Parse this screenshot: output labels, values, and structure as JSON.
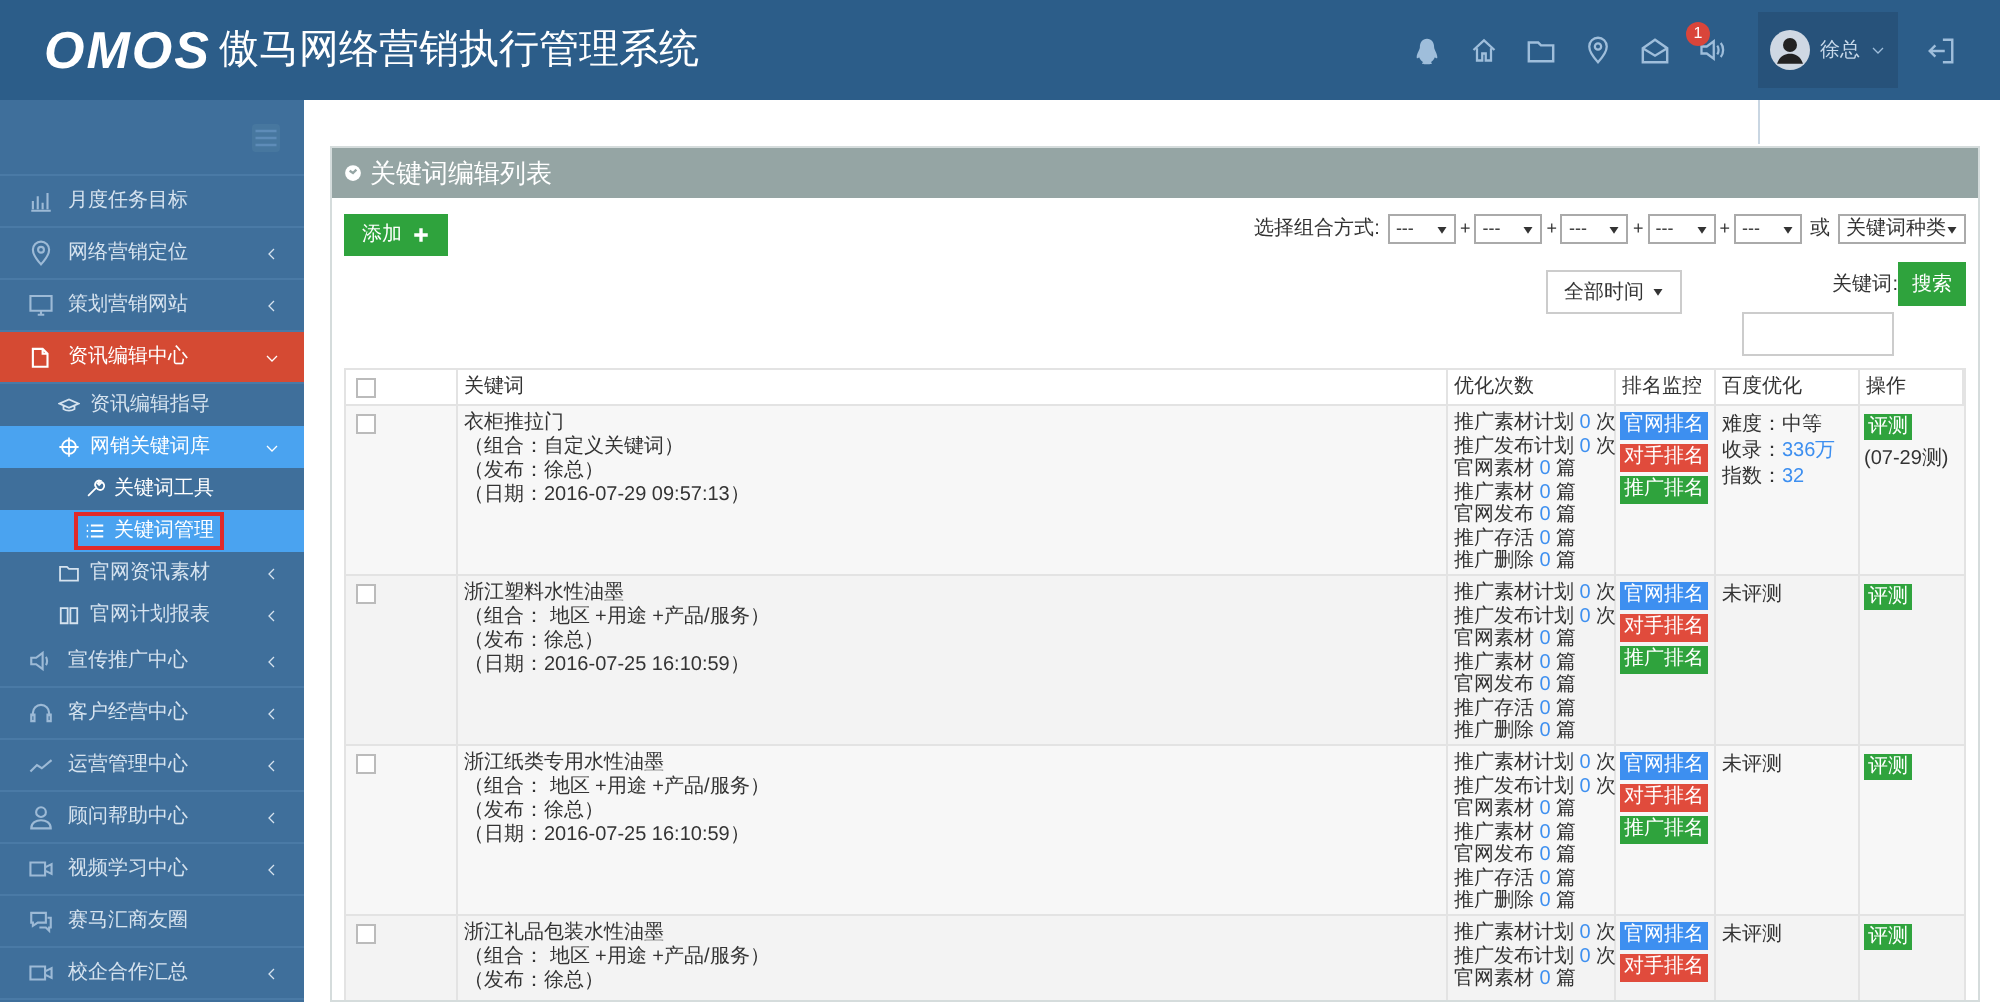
{
  "header": {
    "logo": "OMOS",
    "title": "傲马网络营销执行管理系统",
    "notification_count": "1",
    "user": "徐总"
  },
  "sidebar": {
    "items": [
      {
        "label": "月度任务目标",
        "kind": "link",
        "selected": false
      },
      {
        "label": "网络营销定位",
        "kind": "menu",
        "selected": false,
        "expanded": false
      },
      {
        "label": "策划营销网站",
        "kind": "menu",
        "selected": false,
        "expanded": false
      },
      {
        "label": "资讯编辑中心",
        "kind": "menu",
        "selected": true,
        "expanded": true,
        "children": [
          {
            "label": "资讯编辑指导",
            "kind": "link",
            "selected": false
          },
          {
            "label": "网销关键词库",
            "kind": "menu",
            "selected": true,
            "expanded": true,
            "children": [
              {
                "label": "关键词工具",
                "selected": false,
                "annotated": false
              },
              {
                "label": "关键词管理",
                "selected": true,
                "annotated": true
              }
            ]
          },
          {
            "label": "官网资讯素材",
            "kind": "menu",
            "selected": false,
            "expanded": false
          },
          {
            "label": "官网计划报表",
            "kind": "menu",
            "selected": false,
            "expanded": false
          }
        ]
      },
      {
        "label": "宣传推广中心",
        "kind": "menu",
        "selected": false,
        "expanded": false
      },
      {
        "label": "客户经营中心",
        "kind": "menu",
        "selected": false,
        "expanded": false
      },
      {
        "label": "运营管理中心",
        "kind": "menu",
        "selected": false,
        "expanded": false
      },
      {
        "label": "顾问帮助中心",
        "kind": "menu",
        "selected": false,
        "expanded": false
      },
      {
        "label": "视频学习中心",
        "kind": "menu",
        "selected": false,
        "expanded": false
      },
      {
        "label": "赛马汇商友圈",
        "kind": "link",
        "selected": false
      },
      {
        "label": "校企合作汇总",
        "kind": "menu",
        "selected": false,
        "expanded": false
      }
    ]
  },
  "panel": {
    "title": "关键词编辑列表",
    "add_button": "添加",
    "filters": {
      "label": "选择组合方式:",
      "selects": [
        "---",
        "---",
        "---",
        "---",
        "---"
      ],
      "joiner": "+",
      "or": "或",
      "type_select": "关键词种类",
      "time_select": "全部时间",
      "keyword_label": "关键词:",
      "search_button": "搜索"
    },
    "table": {
      "header_checked": false,
      "columns": [
        "关键词",
        "优化次数",
        "排名监控",
        "百度优化",
        "操作"
      ],
      "rows": [
        {
          "checked": false,
          "keyword": [
            "衣柜推拉门",
            "（组合：自定义关键词）",
            "（发布：徐总）",
            "（日期：2016-07-29 09:57:13）"
          ],
          "counts": [
            {
              "label": "推广素材计划",
              "value": "0",
              "unit": "次"
            },
            {
              "label": "推广发布计划",
              "value": "0",
              "unit": "次"
            },
            {
              "label": "官网素材",
              "value": "0",
              "unit": "篇"
            },
            {
              "label": "推广素材",
              "value": "0",
              "unit": "篇"
            },
            {
              "label": "官网发布",
              "value": "0",
              "unit": "篇"
            },
            {
              "label": "推广存活",
              "value": "0",
              "unit": "篇"
            },
            {
              "label": "推广删除",
              "value": "0",
              "unit": "篇"
            }
          ],
          "rank_buttons": [
            {
              "label": "官网排名",
              "color": "#3d8ff0"
            },
            {
              "label": "对手排名",
              "color": "#e04b3c"
            },
            {
              "label": "推广排名",
              "color": "#2fa33d"
            }
          ],
          "baidu": [
            {
              "label": "难度：中等"
            },
            {
              "label": "收录：",
              "value": "336万"
            },
            {
              "label": "指数：",
              "value": "32"
            }
          ],
          "action": "评测",
          "action_note": "(07-29测)"
        },
        {
          "checked": false,
          "keyword": [
            "浙江塑料水性油墨",
            "（组合： 地区 +用途 +产品/服务）",
            "（发布：徐总）",
            "（日期：2016-07-25 16:10:59）"
          ],
          "counts": [
            {
              "label": "推广素材计划",
              "value": "0",
              "unit": "次"
            },
            {
              "label": "推广发布计划",
              "value": "0",
              "unit": "次"
            },
            {
              "label": "官网素材",
              "value": "0",
              "unit": "篇"
            },
            {
              "label": "推广素材",
              "value": "0",
              "unit": "篇"
            },
            {
              "label": "官网发布",
              "value": "0",
              "unit": "篇"
            },
            {
              "label": "推广存活",
              "value": "0",
              "unit": "篇"
            },
            {
              "label": "推广删除",
              "value": "0",
              "unit": "篇"
            }
          ],
          "rank_buttons": [
            {
              "label": "官网排名",
              "color": "#3d8ff0"
            },
            {
              "label": "对手排名",
              "color": "#e04b3c"
            },
            {
              "label": "推广排名",
              "color": "#2fa33d"
            }
          ],
          "baidu": [
            {
              "label": "未评测"
            }
          ],
          "action": "评测"
        },
        {
          "checked": false,
          "keyword": [
            "浙江纸类专用水性油墨",
            "（组合： 地区 +用途 +产品/服务）",
            "（发布：徐总）",
            "（日期：2016-07-25 16:10:59）"
          ],
          "counts": [
            {
              "label": "推广素材计划",
              "value": "0",
              "unit": "次"
            },
            {
              "label": "推广发布计划",
              "value": "0",
              "unit": "次"
            },
            {
              "label": "官网素材",
              "value": "0",
              "unit": "篇"
            },
            {
              "label": "推广素材",
              "value": "0",
              "unit": "篇"
            },
            {
              "label": "官网发布",
              "value": "0",
              "unit": "篇"
            },
            {
              "label": "推广存活",
              "value": "0",
              "unit": "篇"
            },
            {
              "label": "推广删除",
              "value": "0",
              "unit": "篇"
            }
          ],
          "rank_buttons": [
            {
              "label": "官网排名",
              "color": "#3d8ff0"
            },
            {
              "label": "对手排名",
              "color": "#e04b3c"
            },
            {
              "label": "推广排名",
              "color": "#2fa33d"
            }
          ],
          "baidu": [
            {
              "label": "未评测"
            }
          ],
          "action": "评测"
        },
        {
          "checked": false,
          "keyword": [
            "浙江礼品包装水性油墨",
            "（组合： 地区 +用途 +产品/服务）",
            "（发布：徐总）"
          ],
          "counts": [
            {
              "label": "推广素材计划",
              "value": "0",
              "unit": "次"
            },
            {
              "label": "推广发布计划",
              "value": "0",
              "unit": "次"
            },
            {
              "label": "官网素材",
              "value": "0",
              "unit": "篇"
            }
          ],
          "rank_buttons": [
            {
              "label": "官网排名",
              "color": "#3d8ff0"
            },
            {
              "label": "对手排名",
              "color": "#e04b3c"
            }
          ],
          "baidu": [
            {
              "label": "未评测"
            }
          ],
          "action": "评测"
        }
      ]
    }
  }
}
